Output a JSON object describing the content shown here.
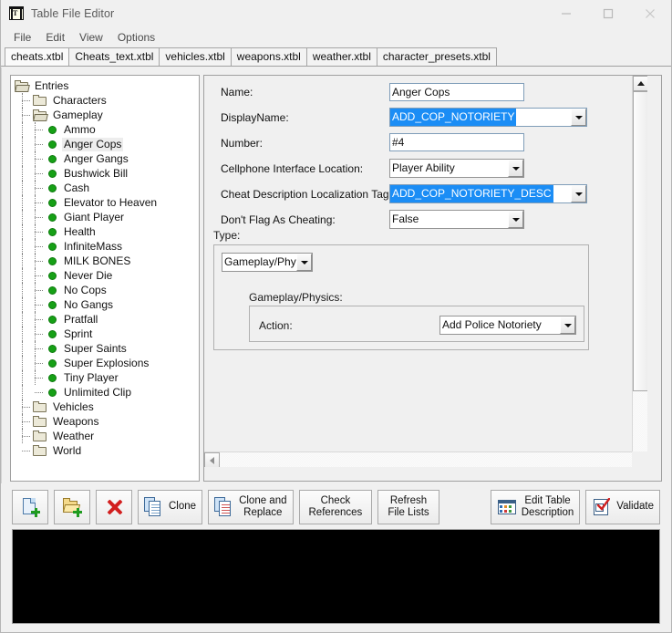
{
  "window": {
    "title": "Table File Editor",
    "icon": "table-file-editor-icon",
    "minimize": "minimize-icon",
    "maximize": "maximize-icon",
    "close": "close-icon"
  },
  "menubar": {
    "items": [
      {
        "label": "File"
      },
      {
        "label": "Edit"
      },
      {
        "label": "View"
      },
      {
        "label": "Options"
      }
    ]
  },
  "tabs": {
    "active_index": 0,
    "items": [
      {
        "label": "cheats.xtbl"
      },
      {
        "label": "Cheats_text.xtbl"
      },
      {
        "label": "vehicles.xtbl"
      },
      {
        "label": "weapons.xtbl"
      },
      {
        "label": "weather.xtbl"
      },
      {
        "label": "character_presets.xtbl"
      }
    ]
  },
  "tree": {
    "root": "Entries",
    "folders": [
      {
        "label": "Characters",
        "open": false
      },
      {
        "label": "Gameplay",
        "open": true
      },
      {
        "label": "Vehicles",
        "open": false
      },
      {
        "label": "Weapons",
        "open": false
      },
      {
        "label": "Weather",
        "open": false
      },
      {
        "label": "World",
        "open": false
      }
    ],
    "gameplay_items": [
      {
        "label": "Ammo",
        "selected": false
      },
      {
        "label": "Anger Cops",
        "selected": true
      },
      {
        "label": "Anger Gangs",
        "selected": false
      },
      {
        "label": "Bushwick Bill",
        "selected": false
      },
      {
        "label": "Cash",
        "selected": false
      },
      {
        "label": "Elevator to Heaven",
        "selected": false
      },
      {
        "label": "Giant Player",
        "selected": false
      },
      {
        "label": "Health",
        "selected": false
      },
      {
        "label": "InfiniteMass",
        "selected": false
      },
      {
        "label": "MILK BONES",
        "selected": false
      },
      {
        "label": "Never Die",
        "selected": false
      },
      {
        "label": "No Cops",
        "selected": false
      },
      {
        "label": "No Gangs",
        "selected": false
      },
      {
        "label": "Pratfall",
        "selected": false
      },
      {
        "label": "Sprint",
        "selected": false
      },
      {
        "label": "Super Saints",
        "selected": false
      },
      {
        "label": "Super Explosions",
        "selected": false
      },
      {
        "label": "Tiny Player",
        "selected": false
      },
      {
        "label": "Unlimited Clip",
        "selected": false
      }
    ]
  },
  "form": {
    "name": {
      "label": "Name:",
      "value": "Anger Cops"
    },
    "display_name": {
      "label": "DisplayName:",
      "value": "ADD_COP_NOTORIETY",
      "selected": true
    },
    "number": {
      "label": "Number:",
      "value": "#4"
    },
    "cellphone_location": {
      "label": "Cellphone Interface Location:",
      "value": "Player Ability"
    },
    "cheat_desc_tag": {
      "label": "Cheat Description Localization Tag:",
      "value": "ADD_COP_NOTORIETY_DESC",
      "selected": true
    },
    "dont_flag": {
      "label": "Don't Flag As Cheating:",
      "value": "False"
    },
    "type": {
      "label": "Type:",
      "value": "Gameplay/Physi",
      "subgroup_label": "Gameplay/Physics:",
      "action": {
        "label": "Action:",
        "value": "Add Police Notoriety"
      }
    }
  },
  "toolbar": {
    "new_file": {
      "icon": "new-file-icon",
      "label": ""
    },
    "open_folder": {
      "icon": "open-folder-icon",
      "label": ""
    },
    "delete": {
      "icon": "red-x-icon",
      "label": ""
    },
    "clone": {
      "icon": "copy-icon",
      "label": "Clone"
    },
    "clone_and_replace": {
      "icon": "copy-replace-icon",
      "label": "Clone and\nReplace"
    },
    "check_references": {
      "label": "Check\nReferences"
    },
    "refresh_file_lists": {
      "label": "Refresh\nFile Lists"
    },
    "edit_table_description": {
      "icon": "table-grid-icon",
      "label": "Edit Table\nDescription"
    },
    "validate": {
      "icon": "checklist-icon",
      "label": "Validate"
    }
  },
  "console": {
    "text": ""
  },
  "colors": {
    "selection_blue": "#1b8df5",
    "bullet_green": "#16a016",
    "field_border": "#7f9db9",
    "window_bg": "#f0f0f0",
    "console_bg": "#000000"
  }
}
